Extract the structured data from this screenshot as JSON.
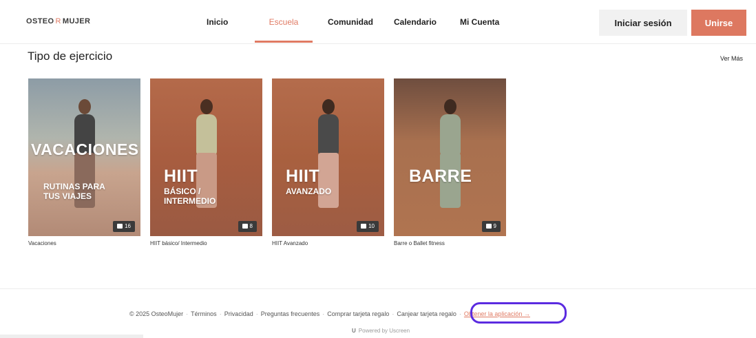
{
  "header": {
    "logo_left": "OSTEO",
    "logo_mark": "R",
    "logo_right": "MUJER",
    "nav": [
      {
        "label": "Inicio"
      },
      {
        "label": "Escuela"
      },
      {
        "label": "Comunidad"
      },
      {
        "label": "Calendario"
      },
      {
        "label": "Mi Cuenta"
      }
    ],
    "login_label": "Iniciar sesión",
    "join_label": "Unirse",
    "accent_color": "#dd7860"
  },
  "section": {
    "title": "Tipo de ejercicio",
    "more_label": "Ver Más"
  },
  "cards": [
    {
      "overlay_title": "VACACIONES",
      "overlay_sub_1": "RUTINAS PARA",
      "overlay_sub_2": "TUS VIAJES",
      "count": "16",
      "label": "Vacaciones"
    },
    {
      "overlay_title": "HIIT",
      "overlay_sub_1": "BÁSICO /",
      "overlay_sub_2": "INTERMEDIO",
      "count": "8",
      "label": "HIIT básico/ Intermedio"
    },
    {
      "overlay_title": "HIIT",
      "overlay_sub_1": "AVANZADO",
      "overlay_sub_2": "",
      "count": "10",
      "label": "HIIT Avanzado"
    },
    {
      "overlay_title": "BARRE",
      "overlay_sub_1": "",
      "overlay_sub_2": "",
      "count": "9",
      "label": "Barre o Ballet fitness"
    }
  ],
  "footer": {
    "copyright": "© 2025 OsteoMujer",
    "links": [
      "Términos",
      "Privacidad",
      "Preguntas frecuentes",
      "Comprar tarjeta regalo",
      "Canjear tarjeta regalo"
    ],
    "app_link": "Obtener la aplicación →",
    "powered": "Powered by Uscreen",
    "highlight_color": "#5b2be0"
  }
}
